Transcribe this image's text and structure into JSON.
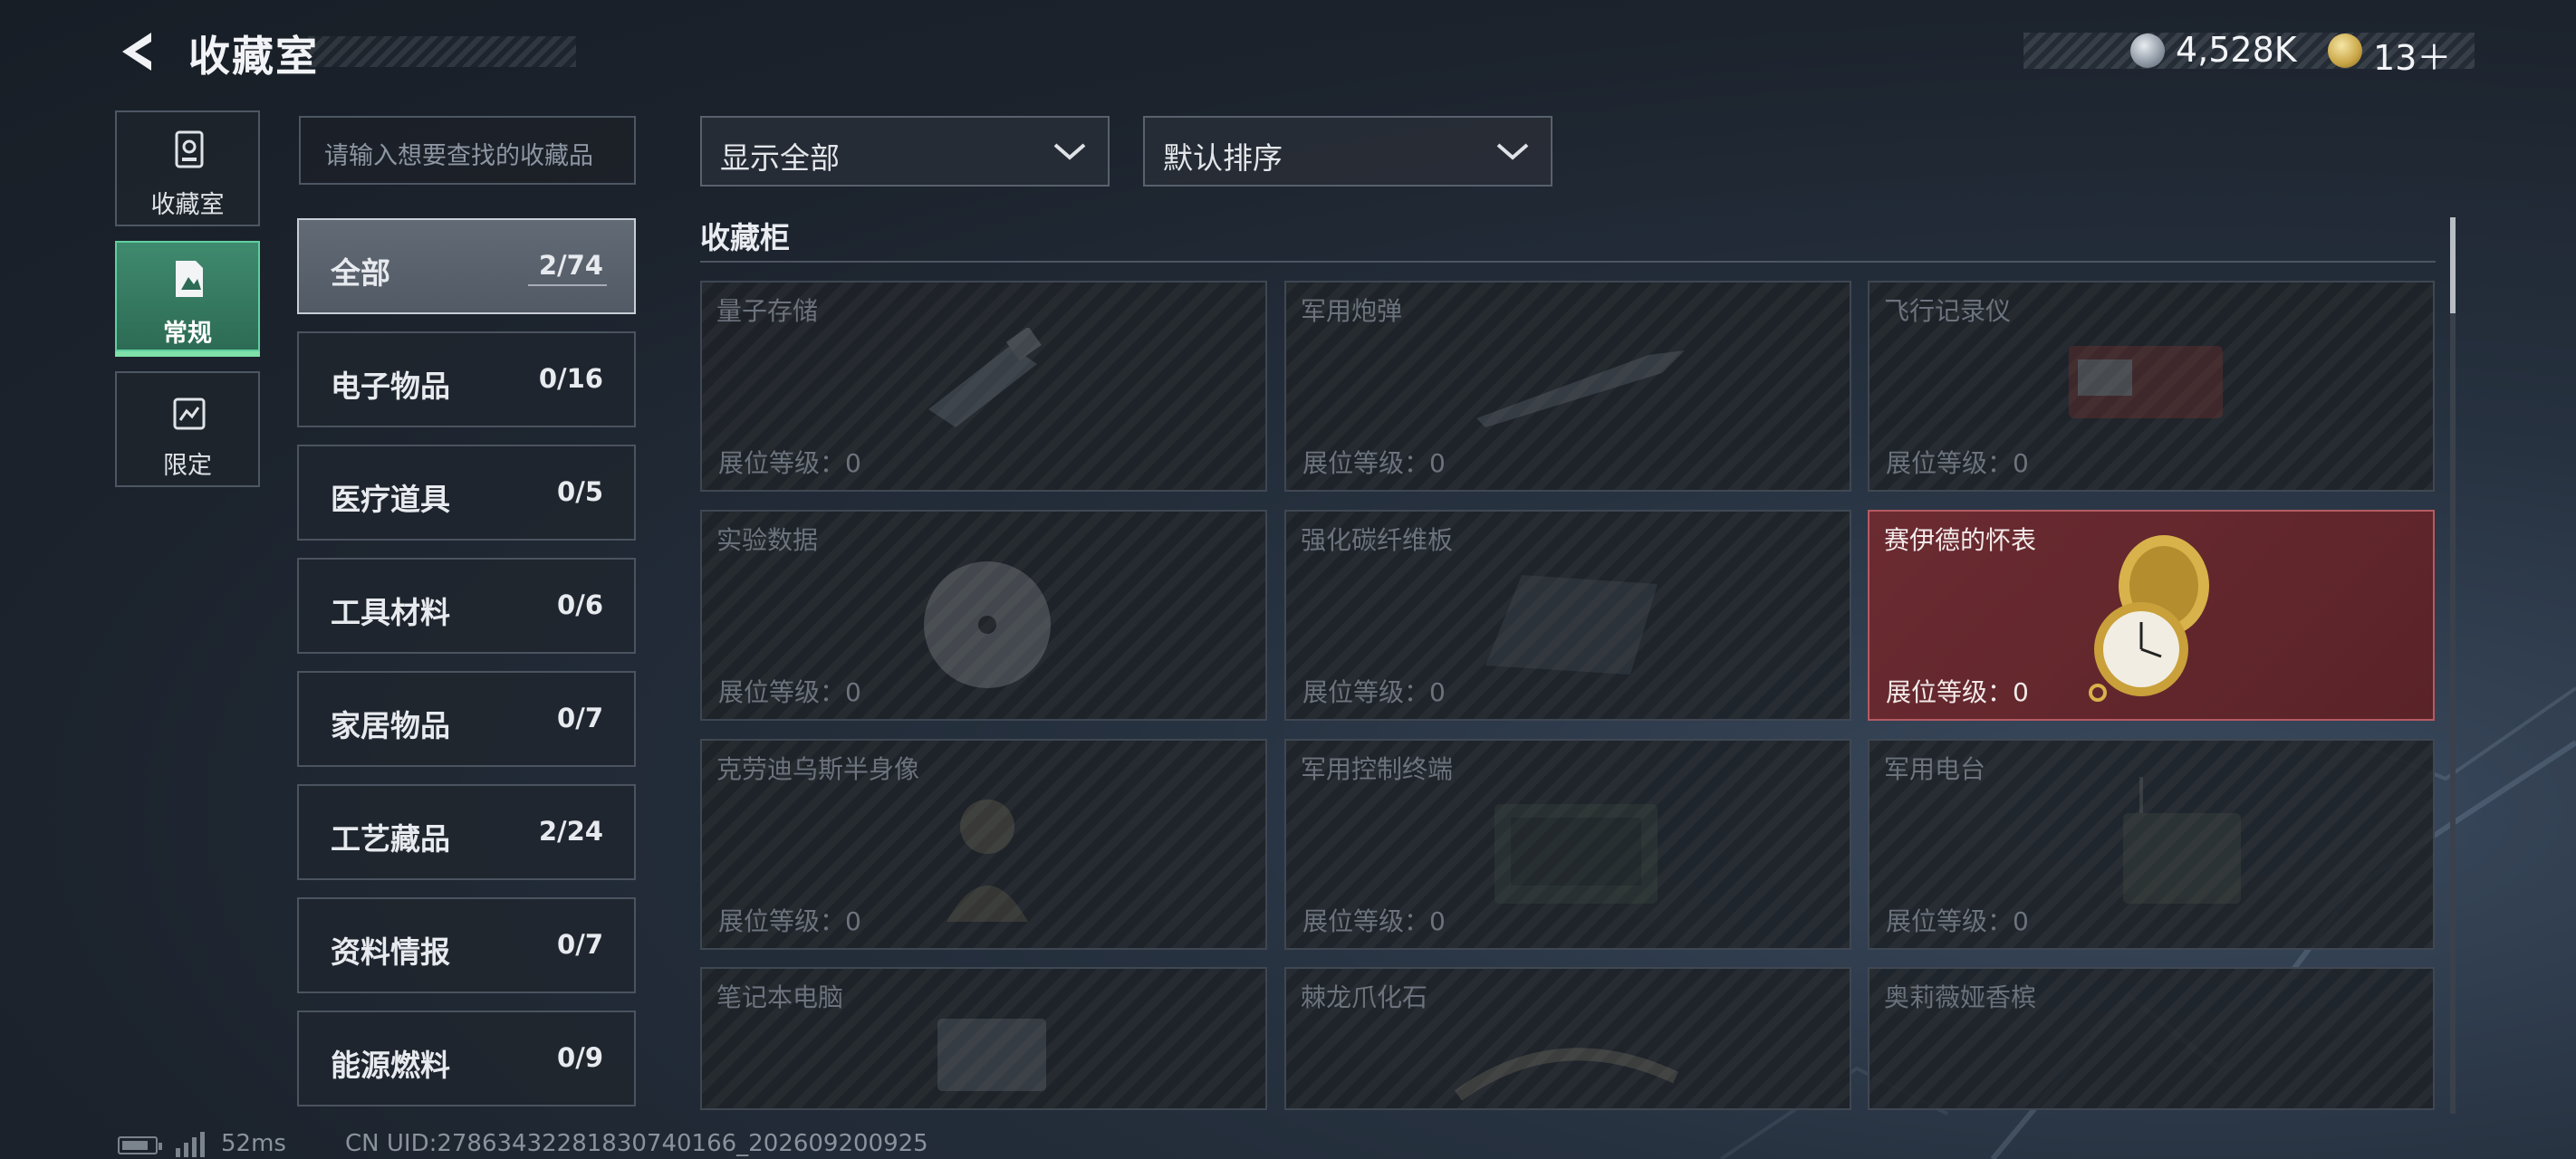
{
  "header": {
    "title": "收藏室",
    "currency_1": "4,528K",
    "currency_2": "13＋"
  },
  "nav": [
    {
      "label": "收藏室",
      "icon": "trophy-case-icon",
      "active": false
    },
    {
      "label": "常规",
      "icon": "document-icon",
      "active": true
    },
    {
      "label": "限定",
      "icon": "limited-card-icon",
      "active": false
    }
  ],
  "search": {
    "placeholder": "请输入想要查找的收藏品"
  },
  "categories": [
    {
      "name": "全部",
      "count": "2/74",
      "active": true
    },
    {
      "name": "电子物品",
      "count": "0/16"
    },
    {
      "name": "医疗道具",
      "count": "0/5"
    },
    {
      "name": "工具材料",
      "count": "0/6"
    },
    {
      "name": "家居物品",
      "count": "0/7"
    },
    {
      "name": "工艺藏品",
      "count": "2/24"
    },
    {
      "name": "资料情报",
      "count": "0/7"
    },
    {
      "name": "能源燃料",
      "count": "0/9"
    }
  ],
  "filters": {
    "show": "显示全部",
    "sort": "默认排序"
  },
  "section": {
    "title": "收藏柜"
  },
  "items": [
    {
      "name": "量子存储",
      "level": "展位等级：0",
      "owned": false
    },
    {
      "name": "军用炮弹",
      "level": "展位等级：0",
      "owned": false
    },
    {
      "name": "飞行记录仪",
      "level": "展位等级：0",
      "owned": false
    },
    {
      "name": "实验数据",
      "level": "展位等级：0",
      "owned": false
    },
    {
      "name": "强化碳纤维板",
      "level": "展位等级：0",
      "owned": false
    },
    {
      "name": "赛伊德的怀表",
      "level": "展位等级：0",
      "owned": true
    },
    {
      "name": "克劳迪乌斯半身像",
      "level": "展位等级：0",
      "owned": false
    },
    {
      "name": "军用控制终端",
      "level": "展位等级：0",
      "owned": false
    },
    {
      "name": "军用电台",
      "level": "展位等级：0",
      "owned": false
    },
    {
      "name": "笔记本电脑",
      "level": "",
      "owned": false
    },
    {
      "name": "棘龙爪化石",
      "level": "",
      "owned": false
    },
    {
      "name": "奥莉薇娅香槟",
      "level": "",
      "owned": false
    }
  ],
  "status": {
    "ping": "52ms",
    "uid": "CN UID:2786343228183074016​6_202609200925"
  },
  "colors": {
    "accent_green": "#5fcf9f",
    "owned_card": "#6b2b31"
  }
}
